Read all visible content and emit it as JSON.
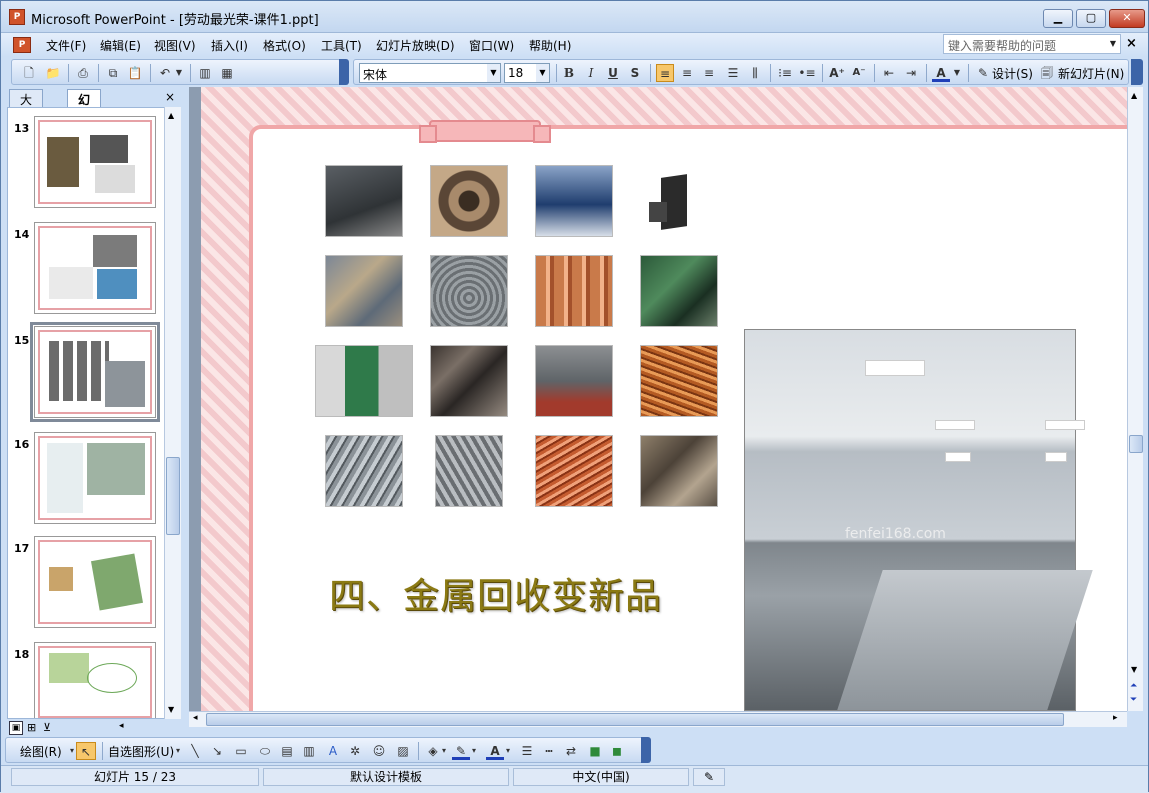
{
  "window": {
    "title": "Microsoft PowerPoint - [劳动最光荣-课件1.ppt]",
    "app_icon": "powerpoint-icon"
  },
  "menu": {
    "items": [
      "文件(F)",
      "编辑(E)",
      "视图(V)",
      "插入(I)",
      "格式(O)",
      "工具(T)",
      "幻灯片放映(D)",
      "窗口(W)",
      "帮助(H)"
    ],
    "help_placeholder": "键入需要帮助的问题"
  },
  "format_toolbar": {
    "font": "宋体",
    "size": "18",
    "bold": "B",
    "italic": "I",
    "underline": "U",
    "shadow": "S",
    "design_label": "设计(S)",
    "new_slide_label": "新幻灯片(N)"
  },
  "left_pane": {
    "tabs": [
      "大纲",
      "幻灯片"
    ],
    "selected_tab": "幻灯片",
    "close": "×",
    "slide_numbers": [
      "13",
      "14",
      "15",
      "16",
      "17",
      "18"
    ],
    "selected_slide": "15"
  },
  "slide": {
    "headline": "四、金属回收变新品",
    "watermark": "fenfei168.com",
    "grid_photos": [
      "conference-table-photo",
      "cable-reel-photo",
      "office-desks-photo",
      "computer-tower-photo",
      "scrap-motors-photo",
      "wire-coils-photo",
      "copper-pipes-photo",
      "circuit-board-scrap-photo",
      "machine-photo",
      "scrap-metal-pile-photo",
      "air-conditioner-scrap-photo",
      "copper-wire-photo",
      "aluminum-scrap-photo",
      "steel-bars-photo",
      "copper-scrap-photo",
      "metal-parts-scrap-photo"
    ],
    "large_photo": "kitchen-stainless-photo"
  },
  "drawing_toolbar": {
    "draw_label": "绘图(R)",
    "autoshapes_label": "自选图形(U)"
  },
  "status": {
    "slide_info": "幻灯片 15 / 23",
    "template": "默认设计模板",
    "language": "中文(中国)"
  },
  "colors": {
    "accent": "#3c64a8",
    "slide_border": "#f0a7a8",
    "headline": "#8b7a14"
  }
}
